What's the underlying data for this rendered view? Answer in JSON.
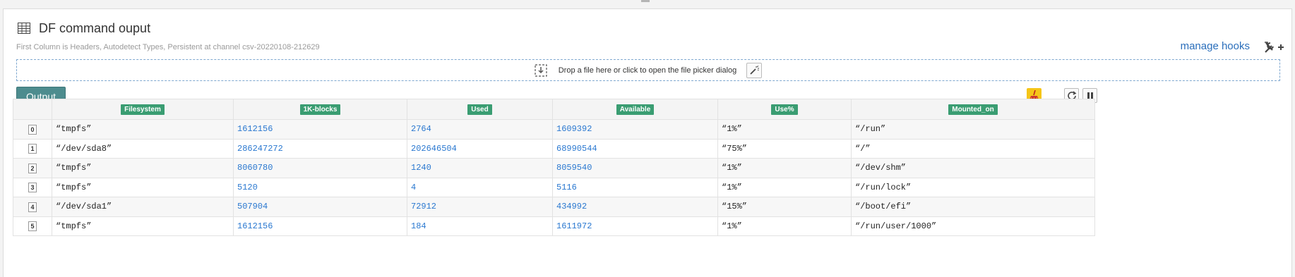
{
  "header": {
    "title": "DF command ouput",
    "subtitle": "First Column is Headers, Autodetect Types, Persistent at channel csv-20220108-212629",
    "manage_hooks": "manage hooks"
  },
  "dropzone": {
    "text": "Drop a file here or click to open the file picker dialog"
  },
  "output_button": "Output",
  "colors": {
    "accent": "#4d8c8e",
    "header_badge": "#3a9d72",
    "link": "#2a6ebb",
    "number": "#2a78d0",
    "clear_button": "#f5c518"
  },
  "icons": [
    "table-icon",
    "tools-plus-icon",
    "file-drop-icon",
    "magic-wand-icon",
    "broom-icon",
    "refresh-icon",
    "pause-icon"
  ],
  "table": {
    "headers": [
      "Filesystem",
      "1K-blocks",
      "Used",
      "Available",
      "Use%",
      "Mounted_on"
    ],
    "rows": [
      [
        "0",
        "“tmpfs”",
        "1612156",
        "2764",
        "1609392",
        "“1%”",
        "“/run”"
      ],
      [
        "1",
        "“/dev/sda8”",
        "286247272",
        "202646504",
        "68990544",
        "“75%”",
        "“/”"
      ],
      [
        "2",
        "“tmpfs”",
        "8060780",
        "1240",
        "8059540",
        "“1%”",
        "“/dev/shm”"
      ],
      [
        "3",
        "“tmpfs”",
        "5120",
        "4",
        "5116",
        "“1%”",
        "“/run/lock”"
      ],
      [
        "4",
        "“/dev/sda1”",
        "507904",
        "72912",
        "434992",
        "“15%”",
        "“/boot/efi”"
      ],
      [
        "5",
        "“tmpfs”",
        "1612156",
        "184",
        "1611972",
        "“1%”",
        "“/run/user/1000”"
      ]
    ]
  }
}
